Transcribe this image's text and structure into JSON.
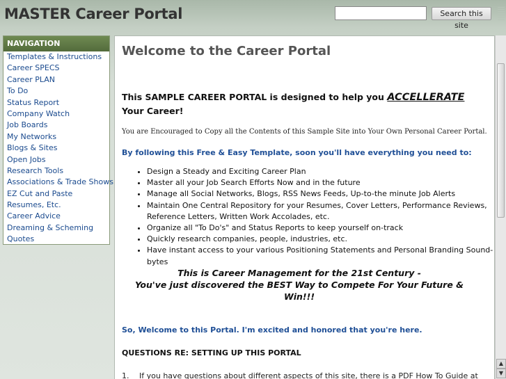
{
  "site": {
    "title": "MASTER Career Portal"
  },
  "search": {
    "placeholder": "",
    "button_label": "Search this site"
  },
  "nav": {
    "header": "NAVIGATION",
    "items": [
      "Templates & Instructions",
      "Career SPECS",
      "Career PLAN",
      "To Do",
      "Status Report",
      "Company Watch",
      "Job Boards",
      "My Networks",
      "Blogs & Sites",
      "Open Jobs",
      "Research Tools",
      "Associations & Trade Shows",
      "EZ Cut and Paste",
      "Resumes, Etc.",
      "Career Advice",
      "Dreaming & Scheming",
      "Quotes"
    ]
  },
  "main": {
    "heading": "Welcome to the Career Portal",
    "intro_before": "This SAMPLE CAREER PORTAL is designed to help you ",
    "intro_accent": "ACCELLERATE",
    "intro_after": " Your Career!",
    "encouraged": "You are Encouraged to Copy all the Contents of this Sample Site into Your Own Personal Career Portal.",
    "following": "By following this Free & Easy Template, soon you'll have everything you need to:",
    "bullets": [
      "Design a Steady and Exciting Career Plan",
      "Master all your Job Search Efforts Now and in the future",
      "Manage all Social Networks, Blogs, RSS News Feeds, Up-to-the minute Job Alerts",
      "Maintain One Central Repository for your Resumes, Cover Letters, Performance Reviews, Reference Letters, Written Work Accolades, etc.",
      "Organize all \"To Do's\" and Status Reports to keep yourself on-track",
      "Quickly research companies, people, industries, etc.",
      "Have instant access to your various Positioning Statements and Personal Branding Sound-bytes"
    ],
    "mgmt_line1": "This is Career Management for the 21st Century -",
    "mgmt_line2": "You've just discovered the BEST Way to Compete For Your Future & Win!!!",
    "welcome2": "So, Welcome to this Portal.  I'm excited and honored that you're here.",
    "questions": "QUESTIONS RE:  SETTING UP THIS PORTAL",
    "q1_num": "1.",
    "q1_text": "If you have questions about different aspects of this site, there is a PDF How To Guide at"
  }
}
